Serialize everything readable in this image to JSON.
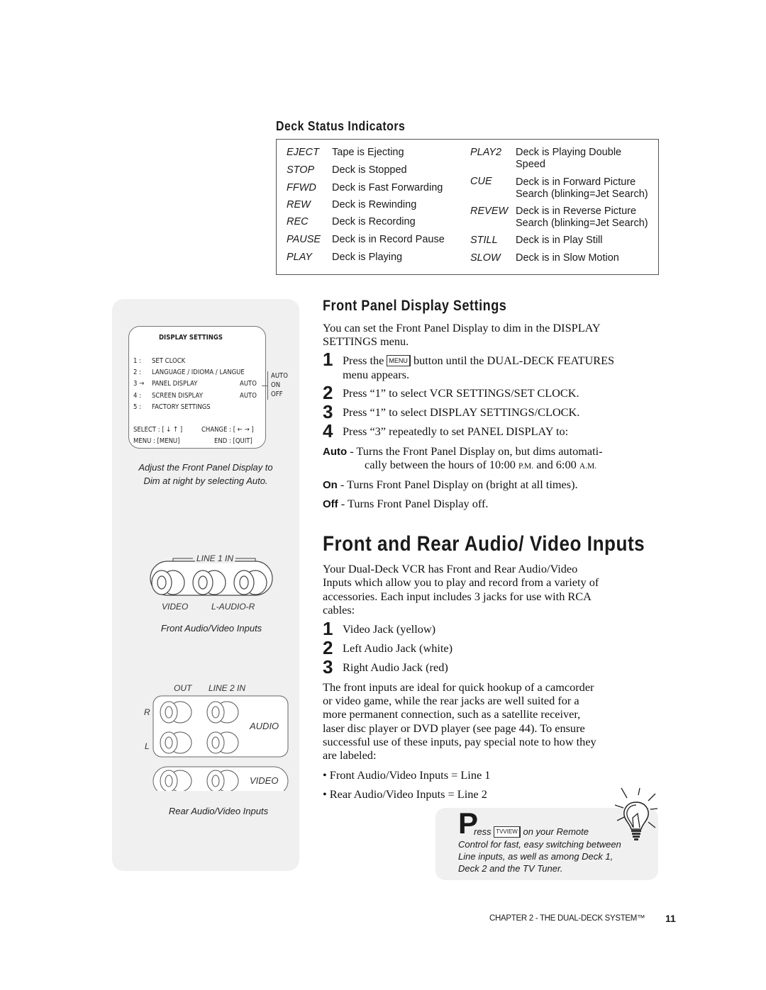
{
  "deck_status": {
    "title": "Deck Status Indicators",
    "left": [
      {
        "code": "EJECT",
        "desc": "Tape is Ejecting"
      },
      {
        "code": "STOP",
        "desc": "Deck is Stopped"
      },
      {
        "code": "FFWD",
        "desc": "Deck is Fast Forwarding"
      },
      {
        "code": "REW",
        "desc": "Deck is Rewinding"
      },
      {
        "code": "REC",
        "desc": "Deck is Recording"
      },
      {
        "code": "PAUSE",
        "desc": "Deck is in Record Pause"
      },
      {
        "code": "PLAY",
        "desc": "Deck is Playing"
      }
    ],
    "right": [
      {
        "code": "PLAY2",
        "desc1": "Deck is Playing Double",
        "desc2": "Speed"
      },
      {
        "code": "CUE",
        "desc1": "Deck is in Forward Picture",
        "desc2": "Search (blinking=Jet Search)"
      },
      {
        "code": "REVEW",
        "desc1": "Deck is in Reverse Picture",
        "desc2": "Search (blinking=Jet Search)"
      },
      {
        "code": "STILL",
        "desc1": "Deck is in Play Still",
        "desc2": ""
      },
      {
        "code": "SLOW",
        "desc1": "Deck is in Slow Motion",
        "desc2": ""
      }
    ]
  },
  "sidebar": {
    "menu_screen": {
      "title": "DISPLAY SETTINGS",
      "items": [
        {
          "num": "1 :",
          "label": "SET CLOCK",
          "value": ""
        },
        {
          "num": "2 :",
          "label": "LANGUAGE / IDIOMA / LANGUE",
          "value": ""
        },
        {
          "num": "3 →",
          "label": "PANEL DISPLAY",
          "value": "AUTO"
        },
        {
          "num": "4 :",
          "label": "SCREEN DISPLAY",
          "value": "AUTO"
        },
        {
          "num": "5 :",
          "label": "FACTORY SETTINGS",
          "value": ""
        }
      ],
      "options": [
        "AUTO",
        "ON",
        "OFF"
      ],
      "select_hint": "SELECT : [ ↓ ↑ ]",
      "change_hint": "CHANGE : [ ← → ]",
      "menu_hint": "MENU : [MENU]",
      "end_hint": "END : [QUIT]"
    },
    "menu_caption_1": "Adjust the Front Panel Display to",
    "menu_caption_2": "Dim at night by selecting Auto.",
    "front_panel": {
      "line_label": "LINE 1 IN",
      "video_label": "VIDEO",
      "audio_label": "L-AUDIO-R",
      "caption": "Front Audio/Video Inputs"
    },
    "rear_panel": {
      "out_label": "OUT",
      "line_label": "LINE 2 IN",
      "r_label": "R",
      "l_label": "L",
      "audio_label": "AUDIO",
      "video_label": "VIDEO",
      "caption": "Rear Audio/Video Inputs"
    }
  },
  "front_panel_settings": {
    "heading": "Front Panel Display Settings",
    "intro_1": "You can set the Front Panel Display to dim in the DISPLAY",
    "intro_2": "SETTINGS menu.",
    "steps": [
      {
        "num": "1",
        "pre": "Press the",
        "key": "MENU",
        "post": "button until the DUAL-DECK FEATURES",
        "line2": "menu appears."
      },
      {
        "num": "2",
        "text": "Press “1” to select VCR SETTINGS/SET CLOCK."
      },
      {
        "num": "3",
        "text": "Press “1” to select DISPLAY SETTINGS/CLOCK."
      },
      {
        "num": "4",
        "text": "Press “3” repeatedly to set PANEL DISPLAY to:"
      }
    ],
    "options": [
      {
        "label": "Auto",
        "text": " -  Turns the Front Panel Display on, but dims automati-",
        "line2_pre": "cally between the hours of 10:00 ",
        "pm": "P.M.",
        "mid": " and 6:00 ",
        "am": "A.M."
      },
      {
        "label": "On",
        "text": " - Turns Front Panel Display on (bright at all times)."
      },
      {
        "label": "Off",
        "text": " - Turns Front Panel Display off."
      }
    ]
  },
  "av_inputs": {
    "heading": "Front and Rear Audio/ Video Inputs",
    "intro": [
      "Your Dual-Deck VCR has Front and Rear Audio/Video",
      "Inputs which allow you to play and record from a variety of",
      "accessories. Each input includes 3 jacks for use with RCA",
      "cables:"
    ],
    "jacks": [
      {
        "num": "1",
        "text": "Video Jack (yellow)"
      },
      {
        "num": "2",
        "text": "Left Audio Jack (white)"
      },
      {
        "num": "3",
        "text": "Right Audio Jack (red)"
      }
    ],
    "body": [
      "The front inputs are ideal for quick hookup of a camcorder",
      "or video game, while the rear jacks are well suited for a",
      "more permanent connection, such as a satellite receiver,",
      "laser disc player or DVD player (see page 44). To ensure",
      "successful use of these inputs, pay special note to how they",
      "are labeled:"
    ],
    "bullets": [
      "• Front Audio/Video Inputs = Line 1",
      "• Rear Audio/Video Inputs = Line 2"
    ]
  },
  "tip": {
    "big_letter": "P",
    "pre": "ress",
    "key": "TVVIEW",
    "post": "on your Remote",
    "lines": [
      "Control for fast, easy switching between",
      "Line inputs, as well as among Deck 1,",
      "Deck 2 and the TV Tuner."
    ],
    "icon": "lightbulb-icon"
  },
  "footer": {
    "chapter": "CHAPTER 2 - THE DUAL-DECK SYSTEM™",
    "page": "11"
  }
}
